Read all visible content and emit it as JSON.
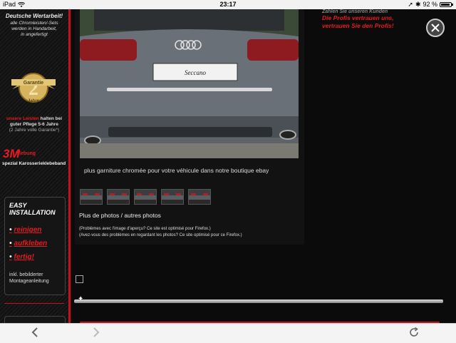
{
  "status": {
    "carrier": "iPad",
    "time": "23:17",
    "battery": "92 %",
    "battery_level": 0.92
  },
  "sidebar": {
    "title": "Deutsche Wertarbeit!",
    "subtitle_lines": [
      "alle Chromleisten/-Sets",
      "werden in Handarbeit,",
      "in angefertigt"
    ],
    "badge_text": "Garantie",
    "badge_number": "2",
    "badge_years": "Jahre",
    "guarantee_red": "unsere Leisten",
    "guarantee_line1": "halten bei",
    "guarantee_line2": "guter Pflege 5-6 Jahre",
    "guarantee_line3": "(2 Jahre volle Garantie*)",
    "logo_3m": "3M",
    "logo_3m_label": "Klebung",
    "klebeband": "spezial Karosserieklebeband",
    "install": {
      "heading_line1": "EASY",
      "heading_line2": "INSTALLATION",
      "steps": [
        "reinigen",
        "aufkleben",
        "fertig!"
      ],
      "inkl_line1": "inkl. bebilderter",
      "inkl_line2": "Montageanleitung"
    }
  },
  "main": {
    "plate_text": "Seccano",
    "caption": "plus garniture chromée pour votre véhicule dans notre boutique ebay",
    "more_photos": "Plus de photos / autres photos",
    "problem_fr": "(Problèmes avec l'image d'aperçu? Ce site est optimisé pour Firefox.)",
    "problem_de": "(Avez-vous des problèmes en regardant les photos? Ce site optimisé pour ce Firefox.)",
    "red_heading_top": "Zahlen Sie unseren Kunden",
    "red_heading_line1": "Die Profis vertrauen uns,",
    "red_heading_line2": "vertrauen Sie den Profis!"
  },
  "icons": {
    "close": "close-icon",
    "back": "back-arrow-icon",
    "forward": "forward-arrow-icon",
    "reload": "reload-icon"
  },
  "colors": {
    "accent_red": "#e31b23",
    "background": "#0b0b0b"
  }
}
